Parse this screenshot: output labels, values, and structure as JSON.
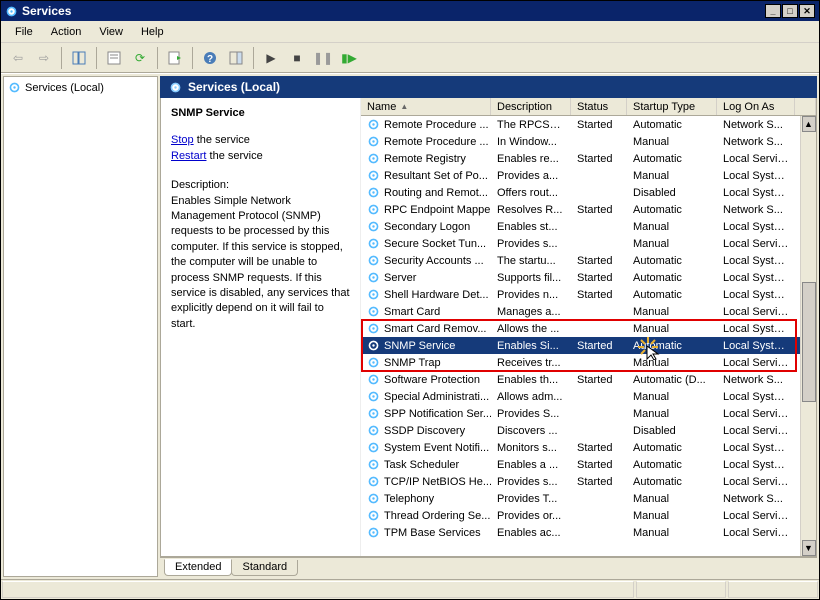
{
  "window": {
    "title": "Services"
  },
  "menu": [
    "File",
    "Action",
    "View",
    "Help"
  ],
  "tree": {
    "root": "Services (Local)"
  },
  "pane": {
    "header": "Services (Local)"
  },
  "detail": {
    "title": "SNMP Service",
    "stop_label": "Stop",
    "stop_suffix": " the service",
    "restart_label": "Restart",
    "restart_suffix": " the service",
    "desc_label": "Description:",
    "description": "Enables Simple Network Management Protocol (SNMP) requests to be processed by this computer. If this service is stopped, the computer will be unable to process SNMP requests. If this service is disabled, any services that explicitly depend on it will fail to start."
  },
  "columns": {
    "name": "Name",
    "description": "Description",
    "status": "Status",
    "startup": "Startup Type",
    "logon": "Log On As"
  },
  "tabs": {
    "extended": "Extended",
    "standard": "Standard"
  },
  "col_widths": {
    "name": 130,
    "description": 80,
    "status": 56,
    "startup": 90,
    "logon": 78
  },
  "services": [
    {
      "name": "Remote Procedure ...",
      "desc": "The RPCSS...",
      "status": "Started",
      "startup": "Automatic",
      "logon": "Network S..."
    },
    {
      "name": "Remote Procedure ...",
      "desc": "In Window...",
      "status": "",
      "startup": "Manual",
      "logon": "Network S..."
    },
    {
      "name": "Remote Registry",
      "desc": "Enables re...",
      "status": "Started",
      "startup": "Automatic",
      "logon": "Local Service"
    },
    {
      "name": "Resultant Set of Po...",
      "desc": "Provides a...",
      "status": "",
      "startup": "Manual",
      "logon": "Local System"
    },
    {
      "name": "Routing and Remot...",
      "desc": "Offers rout...",
      "status": "",
      "startup": "Disabled",
      "logon": "Local System"
    },
    {
      "name": "RPC Endpoint Mapper",
      "desc": "Resolves R...",
      "status": "Started",
      "startup": "Automatic",
      "logon": "Network S..."
    },
    {
      "name": "Secondary Logon",
      "desc": "Enables st...",
      "status": "",
      "startup": "Manual",
      "logon": "Local System"
    },
    {
      "name": "Secure Socket Tun...",
      "desc": "Provides s...",
      "status": "",
      "startup": "Manual",
      "logon": "Local Service"
    },
    {
      "name": "Security Accounts ...",
      "desc": "The startu...",
      "status": "Started",
      "startup": "Automatic",
      "logon": "Local System"
    },
    {
      "name": "Server",
      "desc": "Supports fil...",
      "status": "Started",
      "startup": "Automatic",
      "logon": "Local System"
    },
    {
      "name": "Shell Hardware Det...",
      "desc": "Provides n...",
      "status": "Started",
      "startup": "Automatic",
      "logon": "Local System"
    },
    {
      "name": "Smart Card",
      "desc": "Manages a...",
      "status": "",
      "startup": "Manual",
      "logon": "Local Service"
    },
    {
      "name": "Smart Card Remov...",
      "desc": "Allows the ...",
      "status": "",
      "startup": "Manual",
      "logon": "Local System"
    },
    {
      "name": "SNMP Service",
      "desc": "Enables Si...",
      "status": "Started",
      "startup": "Automatic",
      "logon": "Local System",
      "selected": true
    },
    {
      "name": "SNMP Trap",
      "desc": "Receives tr...",
      "status": "",
      "startup": "Manual",
      "logon": "Local Service"
    },
    {
      "name": "Software Protection",
      "desc": "Enables th...",
      "status": "Started",
      "startup": "Automatic (D...",
      "logon": "Network S..."
    },
    {
      "name": "Special Administrati...",
      "desc": "Allows adm...",
      "status": "",
      "startup": "Manual",
      "logon": "Local System"
    },
    {
      "name": "SPP Notification Ser...",
      "desc": "Provides S...",
      "status": "",
      "startup": "Manual",
      "logon": "Local Service"
    },
    {
      "name": "SSDP Discovery",
      "desc": "Discovers ...",
      "status": "",
      "startup": "Disabled",
      "logon": "Local Service"
    },
    {
      "name": "System Event Notifi...",
      "desc": "Monitors s...",
      "status": "Started",
      "startup": "Automatic",
      "logon": "Local System"
    },
    {
      "name": "Task Scheduler",
      "desc": "Enables a ...",
      "status": "Started",
      "startup": "Automatic",
      "logon": "Local System"
    },
    {
      "name": "TCP/IP NetBIOS He...",
      "desc": "Provides s...",
      "status": "Started",
      "startup": "Automatic",
      "logon": "Local Service"
    },
    {
      "name": "Telephony",
      "desc": "Provides T...",
      "status": "",
      "startup": "Manual",
      "logon": "Network S..."
    },
    {
      "name": "Thread Ordering Se...",
      "desc": "Provides or...",
      "status": "",
      "startup": "Manual",
      "logon": "Local Service"
    },
    {
      "name": "TPM Base Services",
      "desc": "Enables ac...",
      "status": "",
      "startup": "Manual",
      "logon": "Local Service"
    }
  ]
}
